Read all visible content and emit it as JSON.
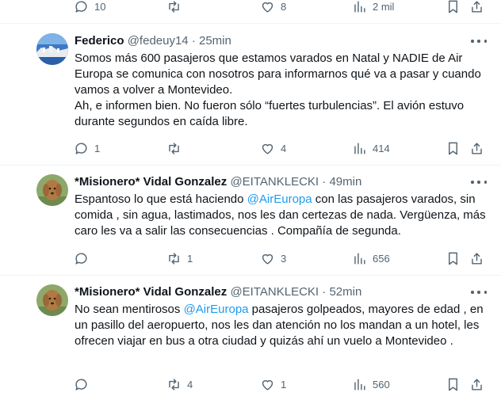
{
  "top_actions": {
    "replies": "10",
    "retweets": "",
    "likes": "8",
    "views": "2 mil"
  },
  "tweets": [
    {
      "name": "Federico",
      "handle": "@fedeuy14",
      "sep": " · ",
      "time": "25min",
      "lines": [
        "Somos más 600 pasajeros que estamos varados en Natal y NADIE de Air Europa se comunica con nosotros para informarnos qué va a pasar y cuando vamos a volver a Montevideo.",
        "Ah, e informen bien. No fueron sólo “fuertes turbulencias”. El avión estuvo durante segundos en caída libre."
      ],
      "actions": {
        "replies": "1",
        "retweets": "",
        "likes": "4",
        "views": "414"
      }
    },
    {
      "name": "*Misionero* Vidal Gonzalez",
      "handle": "@EITANKLECKI",
      "sep": " · ",
      "time": "49min",
      "before": "Espantoso lo que está haciendo ",
      "mention": "@AirEuropa",
      "after": " con las pasajeros varados, sin comida , sin agua, lastimados, nos les dan certezas de nada. Vergüenza, más caro les va a salir las consecuencias . Compañía de segunda.",
      "actions": {
        "replies": "",
        "retweets": "1",
        "likes": "3",
        "views": "656"
      }
    },
    {
      "name": "*Misionero* Vidal Gonzalez",
      "handle": "@EITANKLECKI",
      "sep": " · ",
      "time": "52min",
      "before": "No sean mentirosos ",
      "mention": "@AirEuropa",
      "after": " pasajeros golpeados,  mayores de edad , en un pasillo del aeropuerto, nos les dan atención no los mandan a un hotel, les ofrecen viajar en bus a otra ciudad y quizás ahí un vuelo a Montevideo .",
      "actions": {
        "replies": "",
        "retweets": "4",
        "likes": "1",
        "views": "560"
      }
    }
  ]
}
